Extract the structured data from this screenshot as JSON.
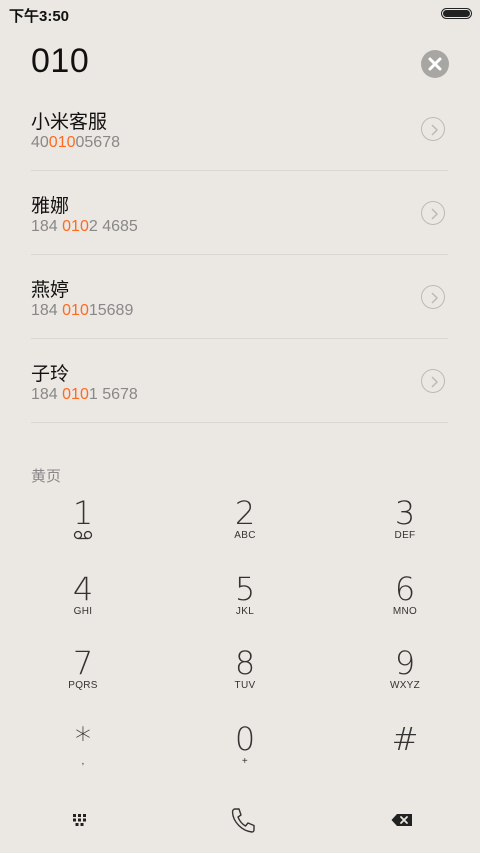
{
  "status_bar": {
    "time": "下午3:50"
  },
  "dialer": {
    "number": "010"
  },
  "results": [
    {
      "name": "小米客服",
      "number_pre": "40",
      "number_hl": "010",
      "number_post": "05678"
    },
    {
      "name": "雅娜",
      "number_pre": "184 ",
      "number_hl": "010",
      "number_post": "2 4685"
    },
    {
      "name": "燕婷",
      "number_pre": "184 ",
      "number_hl": "010",
      "number_post": "15689"
    },
    {
      "name": "子玲",
      "number_pre": "184 ",
      "number_hl": "010",
      "number_post": "1 5678"
    }
  ],
  "yellow_pages": {
    "label": "黄页"
  },
  "keypad": {
    "k1": {
      "digit": "1",
      "sub": "voicemail-icon"
    },
    "k2": {
      "digit": "2",
      "letters": "ABC"
    },
    "k3": {
      "digit": "3",
      "letters": "DEF"
    },
    "k4": {
      "digit": "4",
      "letters": "GHI"
    },
    "k5": {
      "digit": "5",
      "letters": "JKL"
    },
    "k6": {
      "digit": "6",
      "letters": "MNO"
    },
    "k7": {
      "digit": "7",
      "letters": "PQRS"
    },
    "k8": {
      "digit": "8",
      "letters": "TUV"
    },
    "k9": {
      "digit": "9",
      "letters": "WXYZ"
    },
    "kstar": {
      "digit": "*",
      "letters": ","
    },
    "k0": {
      "digit": "0",
      "letters": "+"
    },
    "khash": {
      "digit": "#"
    }
  },
  "bottom_bar": {
    "left": "keypad-grid-icon",
    "center": "phone-icon",
    "right": "backspace-icon"
  },
  "colors": {
    "highlight": "#ff6a1f",
    "background": "#ebe8e3"
  }
}
